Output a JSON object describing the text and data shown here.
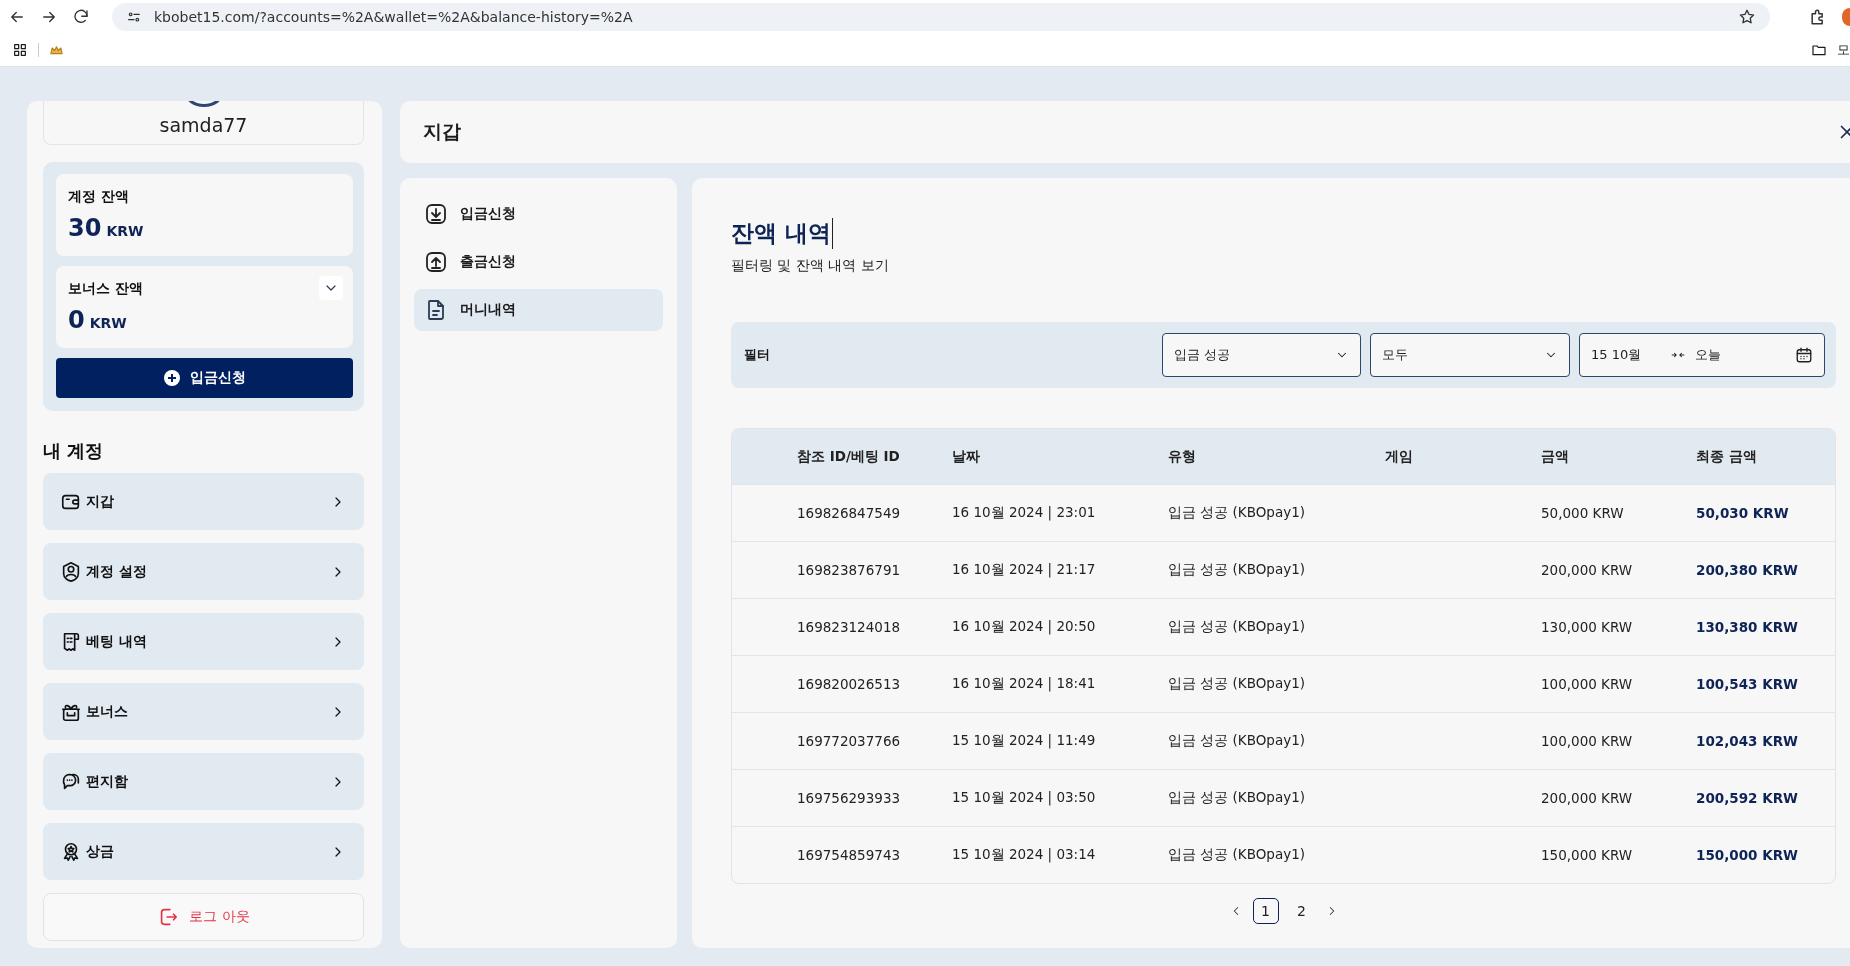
{
  "browser": {
    "url": "kbobet15.com/?accounts=%2A&wallet=%2A&balance-history=%2A",
    "bookmark_folder": "모"
  },
  "sidebar": {
    "username": "samda77",
    "account_balance": {
      "label": "계정 잔액",
      "amount": "30",
      "currency": "KRW"
    },
    "bonus_balance": {
      "label": "보너스 잔액",
      "amount": "0",
      "currency": "KRW",
      "expanded": false
    },
    "deposit_button": "입금신청",
    "section_title": "내 계정",
    "menu": [
      {
        "label": "지갑"
      },
      {
        "label": "계정 설정"
      },
      {
        "label": "베팅 내역"
      },
      {
        "label": "보너스"
      },
      {
        "label": "편지함"
      },
      {
        "label": "상금"
      }
    ],
    "logout": "로그 아웃"
  },
  "header": {
    "title": "지갑"
  },
  "submenu": [
    {
      "label": "입금신청",
      "selected": false
    },
    {
      "label": "출금신청",
      "selected": false
    },
    {
      "label": "머니내역",
      "selected": true
    }
  ],
  "content": {
    "title": "잔액 내역",
    "subtitle": "필터링 및 잔액 내역 보기",
    "filter": {
      "label": "필터",
      "status": "입금 성공",
      "category": "모두",
      "date_from": "15 10월",
      "date_to": "오늘"
    },
    "table": {
      "columns": [
        "참조 ID/베팅 ID",
        "날짜",
        "유형",
        "게임",
        "금액",
        "최종 금액"
      ],
      "rows": [
        {
          "ref_id": "169826847549",
          "date": "16 10월 2024 | 23:01",
          "type": "입금 성공 (KBOpay1)",
          "amount": "50,000 KRW",
          "final_amount": "50,030 KRW"
        },
        {
          "ref_id": "169823876791",
          "date": "16 10월 2024 | 21:17",
          "type": "입금 성공 (KBOpay1)",
          "amount": "200,000 KRW",
          "final_amount": "200,380 KRW"
        },
        {
          "ref_id": "169823124018",
          "date": "16 10월 2024 | 20:50",
          "type": "입금 성공 (KBOpay1)",
          "amount": "130,000 KRW",
          "final_amount": "130,380 KRW"
        },
        {
          "ref_id": "169820026513",
          "date": "16 10월 2024 | 18:41",
          "type": "입금 성공 (KBOpay1)",
          "amount": "100,000 KRW",
          "final_amount": "100,543 KRW"
        },
        {
          "ref_id": "169772037766",
          "date": "15 10월 2024 | 11:49",
          "type": "입금 성공 (KBOpay1)",
          "amount": "100,000 KRW",
          "final_amount": "102,043 KRW"
        },
        {
          "ref_id": "169756293933",
          "date": "15 10월 2024 | 03:50",
          "type": "입금 성공 (KBOpay1)",
          "amount": "200,000 KRW",
          "final_amount": "200,592 KRW"
        },
        {
          "ref_id": "169754859743",
          "date": "15 10월 2024 | 03:14",
          "type": "입금 성공 (KBOpay1)",
          "amount": "150,000 KRW",
          "final_amount": "150,000 KRW"
        }
      ]
    },
    "pagination": [
      {
        "label": "1",
        "selected": true
      },
      {
        "label": "2",
        "selected": false
      }
    ]
  }
}
